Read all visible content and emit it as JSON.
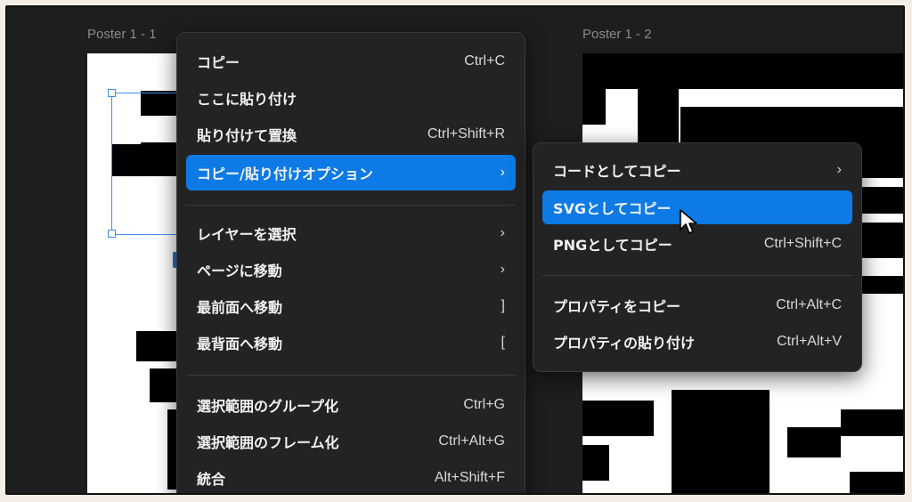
{
  "posters": [
    {
      "label": "Poster 1 - 1"
    },
    {
      "label": "Poster 1 - 2"
    }
  ],
  "context_menu": {
    "items": [
      {
        "label": "コピー",
        "shortcut": "Ctrl+C"
      },
      {
        "label": "ここに貼り付け",
        "shortcut": ""
      },
      {
        "label": "貼り付けて置換",
        "shortcut": "Ctrl+Shift+R"
      },
      {
        "label": "コピー/貼り付けオプション",
        "shortcut": "›",
        "active": true
      },
      {
        "label": "レイヤーを選択",
        "shortcut": "›"
      },
      {
        "label": "ページに移動",
        "shortcut": "›"
      },
      {
        "label": "最前面へ移動",
        "shortcut": "]"
      },
      {
        "label": "最背面へ移動",
        "shortcut": "["
      },
      {
        "label": "選択範囲のグループ化",
        "shortcut": "Ctrl+G"
      },
      {
        "label": "選択範囲のフレーム化",
        "shortcut": "Ctrl+Alt+G"
      },
      {
        "label": "統合",
        "shortcut": "Alt+Shift+F"
      }
    ]
  },
  "submenu": {
    "items": [
      {
        "label": "コードとしてコピー",
        "shortcut": "›"
      },
      {
        "label": "SVGとしてコピー",
        "shortcut": "",
        "active": true
      },
      {
        "label": "PNGとしてコピー",
        "shortcut": "Ctrl+Shift+C"
      },
      {
        "label": "プロパティをコピー",
        "shortcut": "Ctrl+Alt+C"
      },
      {
        "label": "プロパティの貼り付け",
        "shortcut": "Ctrl+Alt+V"
      }
    ]
  },
  "colors": {
    "accent": "#0d7ae5",
    "menu_bg": "#232323",
    "canvas_bg": "#1e1e1e"
  }
}
